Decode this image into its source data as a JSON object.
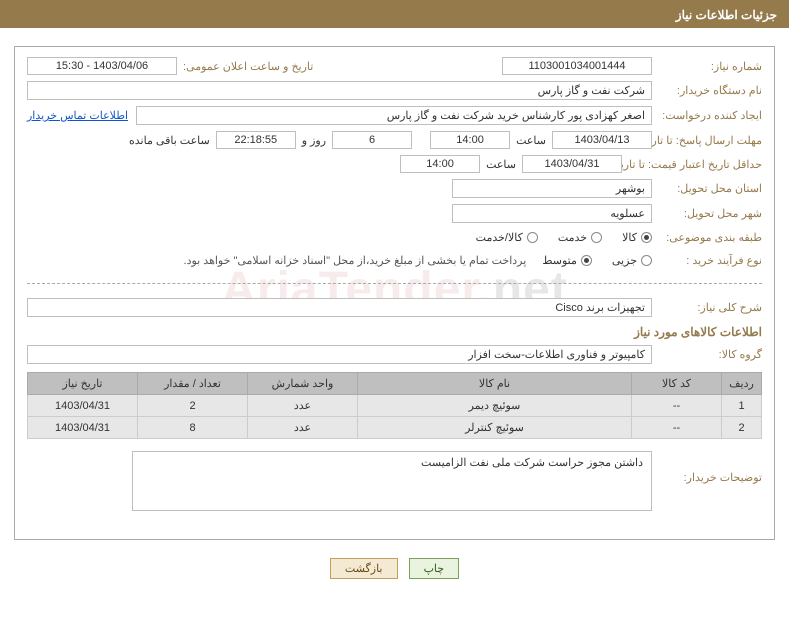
{
  "header": {
    "title": "جزئیات اطلاعات نیاز"
  },
  "watermark": {
    "part1": "AriaTender",
    "part2": ".net"
  },
  "need": {
    "need_number_label": "شماره نیاز:",
    "need_number": "1103001034001444",
    "announce_datetime_label": "تاریخ و ساعت اعلان عمومی:",
    "announce_datetime": "1403/04/06 - 15:30",
    "buyer_org_label": "نام دستگاه خریدار:",
    "buyer_org": "شرکت نفت و گاز پارس",
    "requester_label": "ایجاد کننده درخواست:",
    "requester": "اصغر کهزادی پور کارشناس خرید شرکت نفت و گاز پارس",
    "contact_link": "اطلاعات تماس خریدار",
    "deadline_label": "مهلت ارسال پاسخ: تا تاریخ:",
    "deadline_date": "1403/04/13",
    "hour_word": "ساعت",
    "deadline_time": "14:00",
    "days_remaining": "6",
    "days_word": "روز و",
    "time_remaining": "22:18:55",
    "remaining_word": "ساعت باقی مانده",
    "validity_label": "حداقل تاریخ اعتبار قیمت: تا تاریخ:",
    "validity_date": "1403/04/31",
    "validity_time": "14:00",
    "province_label": "استان محل تحویل:",
    "province": "بوشهر",
    "city_label": "شهر محل تحویل:",
    "city": "عسلویه",
    "category_label": "طبقه بندی موضوعی:",
    "cat_opt_goods": "کالا",
    "cat_opt_service": "خدمت",
    "cat_opt_both": "کالا/خدمت",
    "process_label": "نوع فرآیند خرید :",
    "proc_opt_partial": "جزیی",
    "proc_opt_medium": "متوسط",
    "process_note": "پرداخت تمام یا بخشی از مبلغ خرید،از محل \"اسناد خزانه اسلامی\" خواهد بود.",
    "description_label": "شرح کلی نیاز:",
    "description": "تجهیزات برند Cisco",
    "goods_info_title": "اطلاعات کالاهای مورد نیاز",
    "goods_group_label": "گروه کالا:",
    "goods_group": "کامپیوتر و فناوری اطلاعات-سخت افزار",
    "buyer_notes_label": "توضیحات خریدار:",
    "buyer_notes": "داشتن مجوز حراست شرکت ملی نفت الزامیست"
  },
  "table": {
    "headers": {
      "row": "ردیف",
      "code": "کد کالا",
      "name": "نام کالا",
      "unit": "واحد شمارش",
      "qty": "تعداد / مقدار",
      "date": "تاریخ نیاز"
    },
    "rows": [
      {
        "row": "1",
        "code": "--",
        "name": "سوئیچ دیمر",
        "unit": "عدد",
        "qty": "2",
        "date": "1403/04/31"
      },
      {
        "row": "2",
        "code": "--",
        "name": "سوئیچ کنترلر",
        "unit": "عدد",
        "qty": "8",
        "date": "1403/04/31"
      }
    ]
  },
  "buttons": {
    "print": "چاپ",
    "back": "بازگشت"
  }
}
